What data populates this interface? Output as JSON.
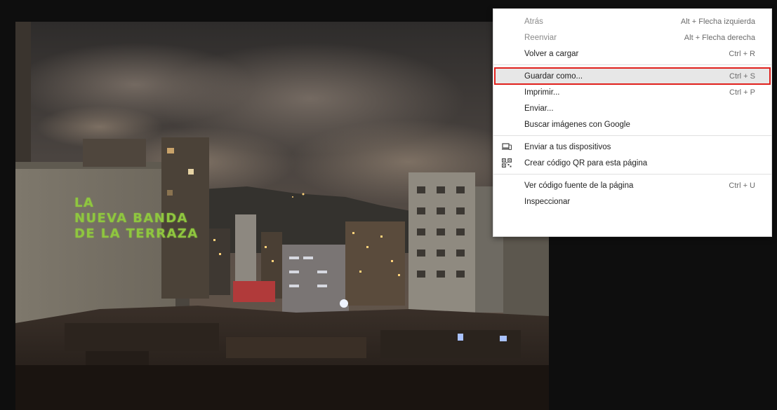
{
  "photo": {
    "mural_lines": [
      "LA",
      "NUEVA BANDA",
      "DE LA TERRAZA"
    ]
  },
  "context_menu": {
    "groups": [
      [
        {
          "label": "Atrás",
          "shortcut": "Alt + Flecha izquierda",
          "enabled": false
        },
        {
          "label": "Reenviar",
          "shortcut": "Alt + Flecha derecha",
          "enabled": false
        },
        {
          "label": "Volver a cargar",
          "shortcut": "Ctrl + R",
          "enabled": true
        }
      ],
      [
        {
          "label": "Guardar como...",
          "shortcut": "Ctrl + S",
          "enabled": true,
          "highlighted": true
        },
        {
          "label": "Imprimir...",
          "shortcut": "Ctrl + P",
          "enabled": true
        },
        {
          "label": "Enviar...",
          "shortcut": "",
          "enabled": true
        },
        {
          "label": "Buscar imágenes con Google",
          "shortcut": "",
          "enabled": true
        }
      ],
      [
        {
          "label": "Enviar a tus dispositivos",
          "shortcut": "",
          "enabled": true,
          "icon": "devices-icon"
        },
        {
          "label": "Crear código QR para esta página",
          "shortcut": "",
          "enabled": true,
          "icon": "qr-code-icon"
        }
      ],
      [
        {
          "label": "Ver código fuente de la página",
          "shortcut": "Ctrl + U",
          "enabled": true
        },
        {
          "label": "Inspeccionar",
          "shortcut": "",
          "enabled": true
        }
      ]
    ],
    "highlight_color": "#e0201c"
  }
}
